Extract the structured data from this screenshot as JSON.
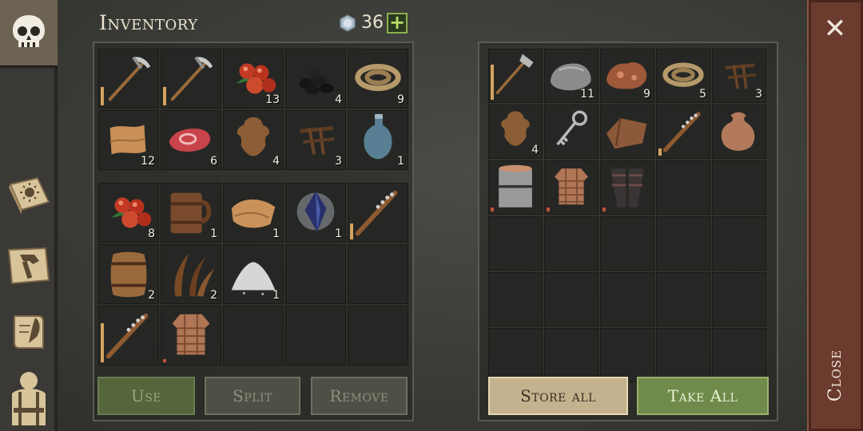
{
  "header": {
    "title": "Inventory",
    "gem_count": "36",
    "add_label": "+"
  },
  "sidebar": {
    "items": [
      {
        "icon": "skull-icon"
      },
      {
        "icon": "sun-book-icon"
      },
      {
        "icon": "crafting-hammer-icon"
      },
      {
        "icon": "scroll-quill-icon"
      },
      {
        "icon": "character-vest-icon"
      }
    ]
  },
  "inventory_top": [
    {
      "item": "pickaxe-icon",
      "count": "",
      "durability": 0.45
    },
    {
      "item": "pickaxe-icon",
      "count": "",
      "durability": 0.45
    },
    {
      "item": "berries-icon",
      "count": "13"
    },
    {
      "item": "coal-icon",
      "count": "4"
    },
    {
      "item": "rope-icon",
      "count": "9"
    },
    {
      "item": "fabric-icon",
      "count": "12"
    },
    {
      "item": "raw-meat-icon",
      "count": "6"
    },
    {
      "item": "hide-icon",
      "count": "4"
    },
    {
      "item": "nails-icon",
      "count": "3"
    },
    {
      "item": "bottle-icon",
      "count": "1"
    }
  ],
  "inventory_bottom": [
    {
      "item": "berries-icon",
      "count": "8"
    },
    {
      "item": "mug-icon",
      "count": "1"
    },
    {
      "item": "leather-icon",
      "count": "1"
    },
    {
      "item": "crystal-icon",
      "count": "1"
    },
    {
      "item": "spiked-club-icon",
      "count": "",
      "durability": 0.38
    },
    {
      "item": "barrel-icon",
      "count": "2"
    },
    {
      "item": "fiber-icon",
      "count": "2"
    },
    {
      "item": "salt-pile-icon",
      "count": "1"
    },
    {
      "item": "",
      "count": ""
    },
    {
      "item": "",
      "count": ""
    },
    {
      "item": "spiked-club-icon",
      "count": "",
      "durability": 0.95
    },
    {
      "item": "chainmail-icon",
      "count": "",
      "durability": 0.08,
      "durability_status": "low"
    },
    {
      "item": "",
      "count": ""
    },
    {
      "item": "",
      "count": ""
    },
    {
      "item": "",
      "count": ""
    }
  ],
  "container": [
    {
      "item": "hatchet-icon",
      "count": "",
      "durability": 0.95
    },
    {
      "item": "stone-icon",
      "count": "11"
    },
    {
      "item": "copper-ore-icon",
      "count": "9"
    },
    {
      "item": "rope-icon",
      "count": "5"
    },
    {
      "item": "nails-icon",
      "count": "3"
    },
    {
      "item": "hide-icon",
      "count": "4"
    },
    {
      "item": "key-icon",
      "count": ""
    },
    {
      "item": "cloth-icon",
      "count": ""
    },
    {
      "item": "spiked-club-icon",
      "count": "",
      "durability": 0.2
    },
    {
      "item": "sack-icon",
      "count": ""
    },
    {
      "item": "knight-helmet-icon",
      "count": "",
      "durability": 0.1,
      "durability_status": "low"
    },
    {
      "item": "chainmail-icon",
      "count": "",
      "durability": 0.1,
      "durability_status": "low"
    },
    {
      "item": "leg-armor-icon",
      "count": "",
      "durability": 0.1,
      "durability_status": "low"
    }
  ],
  "buttons": {
    "use": "Use",
    "split": "Split",
    "remove": "Remove",
    "store_all": "Store all",
    "take_all": "Take All"
  },
  "close": {
    "label": "Close",
    "x": "✕"
  },
  "colors": {
    "accent_green": "#6f8a4a",
    "close_rail": "#6b3b2e",
    "durability": "#d3a35f",
    "durability_low": "#c2513b"
  }
}
